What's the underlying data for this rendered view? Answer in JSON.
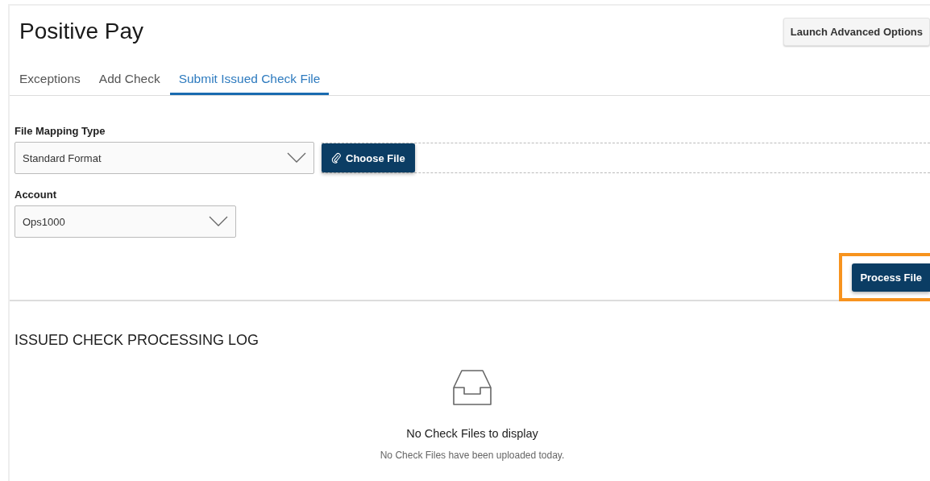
{
  "page_title": "Positive Pay",
  "header_button": "Launch Advanced Options",
  "tabs": [
    {
      "label": "Exceptions",
      "selected": false
    },
    {
      "label": "Add Check",
      "selected": false
    },
    {
      "label": "Submit Issued Check File",
      "selected": true
    }
  ],
  "form": {
    "file_mapping_type": {
      "label": "File Mapping Type",
      "value": "Standard Format"
    },
    "choose_file_button": "Choose File",
    "account": {
      "label": "Account",
      "value": "Ops1000"
    },
    "process_button": {
      "label": "Process File",
      "highlighted": true
    }
  },
  "log": {
    "title": "ISSUED CHECK PROCESSING LOG",
    "empty_title": "No Check Files to display",
    "empty_text": "No Check Files have been uploaded today."
  }
}
